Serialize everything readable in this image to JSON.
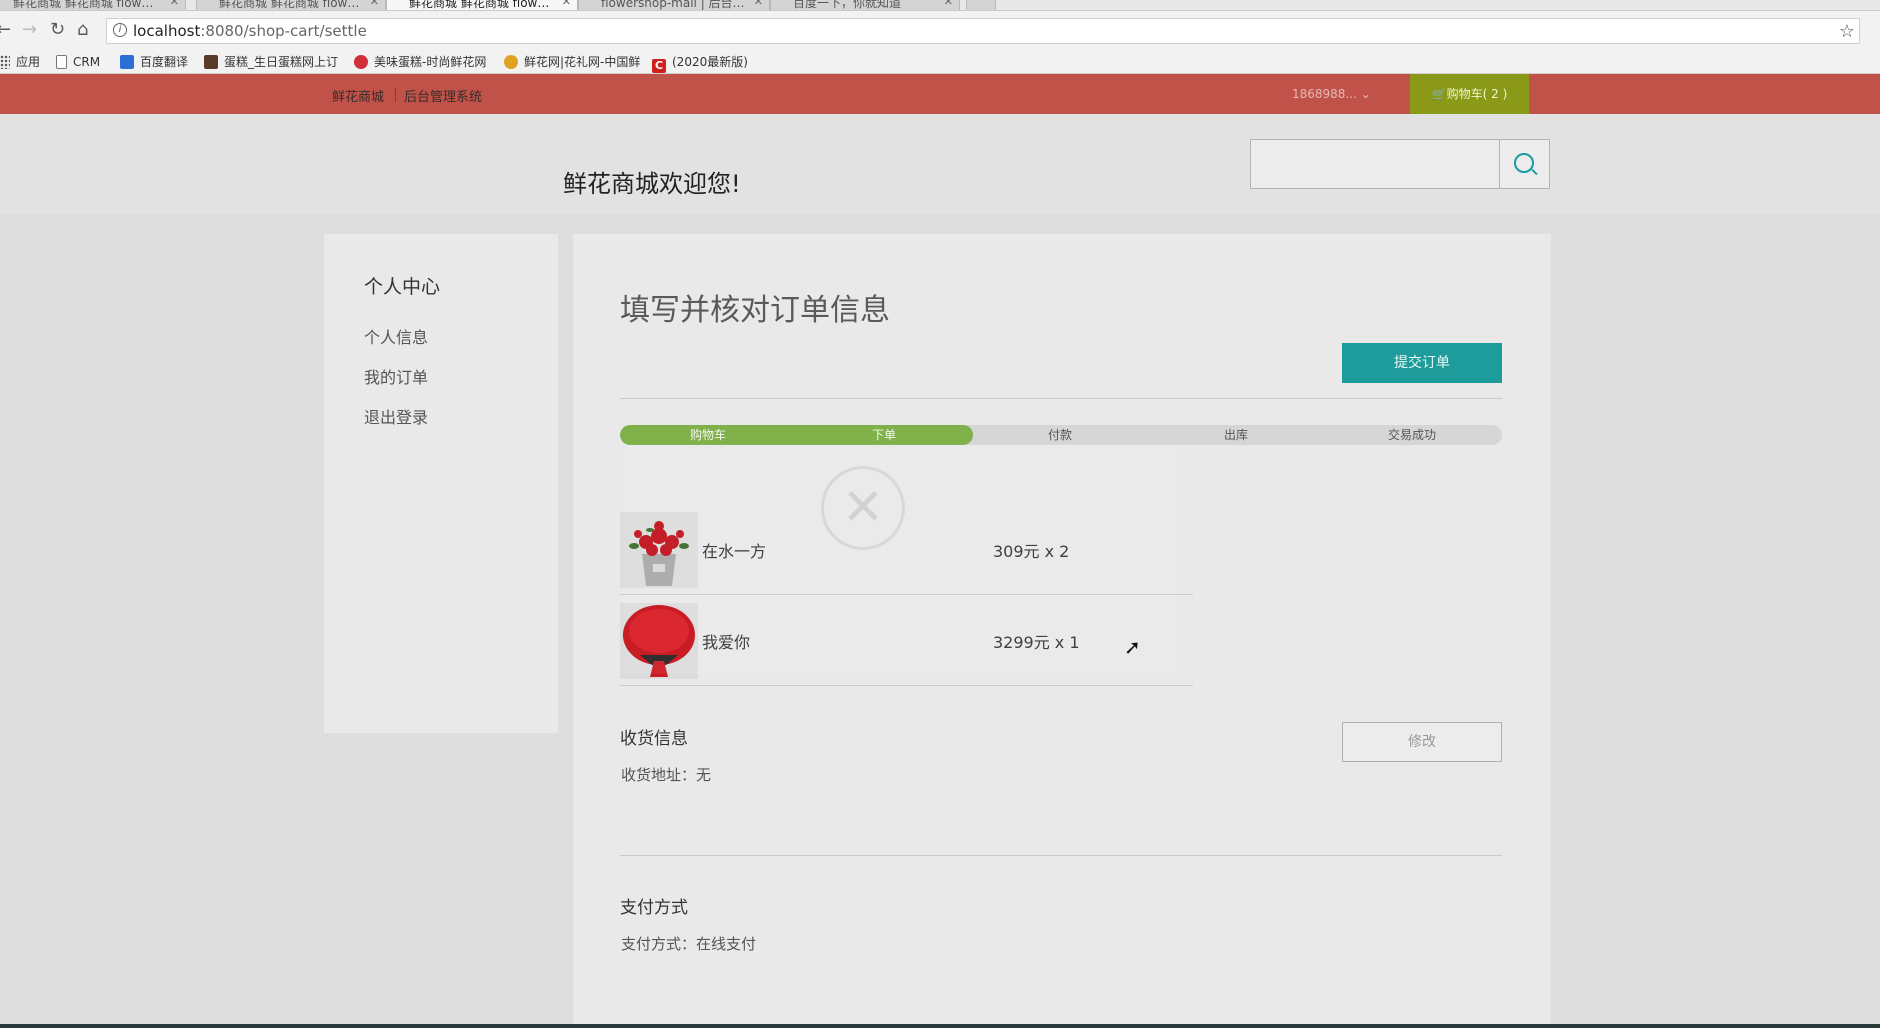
{
  "browser": {
    "tabs": [
      {
        "label": "鲜花商城 鲜花商城 flow…",
        "active": false
      },
      {
        "label": "鲜花商城 鲜花商城 flow…",
        "active": false
      },
      {
        "label": "鲜花商城 鲜花商城 flow…",
        "active": true
      },
      {
        "label": "flowershop-mall | 后台…",
        "active": false
      },
      {
        "label": "百度一下，你就知道",
        "active": false
      }
    ],
    "url_host": "localhost",
    "url_path": ":8080/shop-cart/settle",
    "bookmarks": [
      {
        "label": "应用",
        "icon": "apps-icon"
      },
      {
        "label": "CRM",
        "icon": "page-icon"
      },
      {
        "label": "百度翻译",
        "icon": "baidu-translate-icon"
      },
      {
        "label": "蛋糕_生日蛋糕网上订",
        "icon": "cake-icon"
      },
      {
        "label": "美味蛋糕-时尚鲜花网",
        "icon": "flower-icon"
      },
      {
        "label": "鲜花网|花礼网-中国鲜",
        "icon": "flower-icon"
      },
      {
        "label": "(2020最新版)",
        "icon": "c-icon"
      }
    ]
  },
  "site": {
    "topbar": {
      "mall_link": "鲜花商城",
      "admin_link": "后台管理系统",
      "user": "1868988...",
      "cart": "购物车( 2 )"
    },
    "welcome": "鲜花商城欢迎您!",
    "search_placeholder": ""
  },
  "sidebar": {
    "title": "个人中心",
    "items": [
      "个人信息",
      "我的订单",
      "退出登录"
    ]
  },
  "main": {
    "title": "填写并核对订单信息",
    "submit_label": "提交订单",
    "progress": {
      "steps": [
        "购物车",
        "下单",
        "付款",
        "出库",
        "交易成功"
      ],
      "completed": 2,
      "fill_fraction": 0.4
    },
    "items": [
      {
        "name": "在水一方",
        "price": "309元 x 2"
      },
      {
        "name": "我爱你",
        "price": "3299元 x 1"
      }
    ],
    "shipping": {
      "title": "收货信息",
      "address": "收货地址：无",
      "edit_label": "修改"
    },
    "payment": {
      "title": "支付方式",
      "method": "支付方式：在线支付"
    }
  },
  "colors": {
    "topbar": "#c0524a",
    "cart": "#8a9a18",
    "accent": "#1e9c9c",
    "progress_done": "#7fb04a"
  }
}
